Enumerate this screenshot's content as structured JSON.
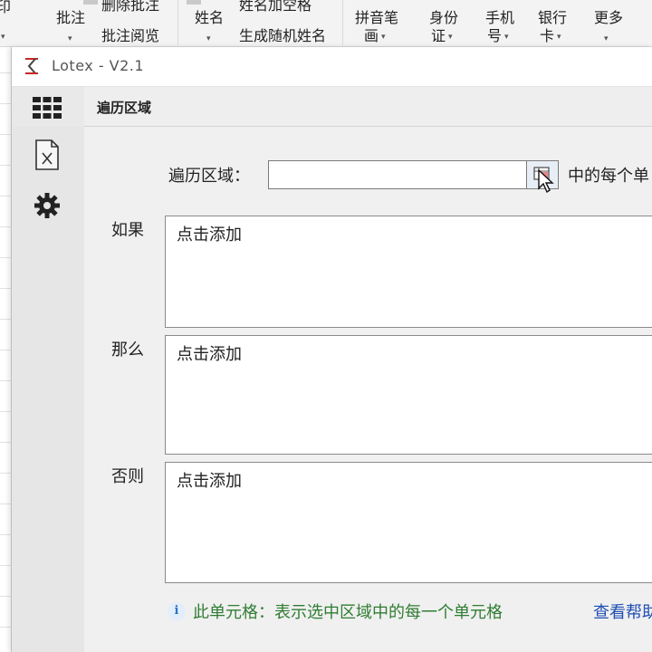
{
  "ribbon": {
    "partial_left": "印",
    "comment": "批注",
    "delete_comments": "删除批注",
    "view_comments": "批注阅览",
    "name": "姓名",
    "name_add_space": "姓名加空格",
    "random_name": "生成随机姓名",
    "pinyin_1": "拼音笔",
    "pinyin_2": "画",
    "id_1": "身份",
    "id_2": "证",
    "phone_1": "手机",
    "phone_2": "号",
    "bank_1": "银行",
    "bank_2": "卡",
    "more": "更多"
  },
  "window": {
    "title": "Lotex - V2.1",
    "sidebar": [
      {
        "icon": "grid-apps-icon"
      },
      {
        "icon": "excel-file-icon"
      },
      {
        "icon": "gear-icon"
      }
    ],
    "tab_label": "遍历区域"
  },
  "form": {
    "range_label": "遍历区域：",
    "range_value": "",
    "range_suffix": "中的每个单",
    "if_label": "如果",
    "then_label": "那么",
    "else_label": "否则",
    "if_text": "点击添加",
    "then_text": "点击添加",
    "else_text": "点击添加",
    "info_text": "此单元格：表示选中区域中的每一个单元格",
    "help_link": "查看帮助"
  }
}
